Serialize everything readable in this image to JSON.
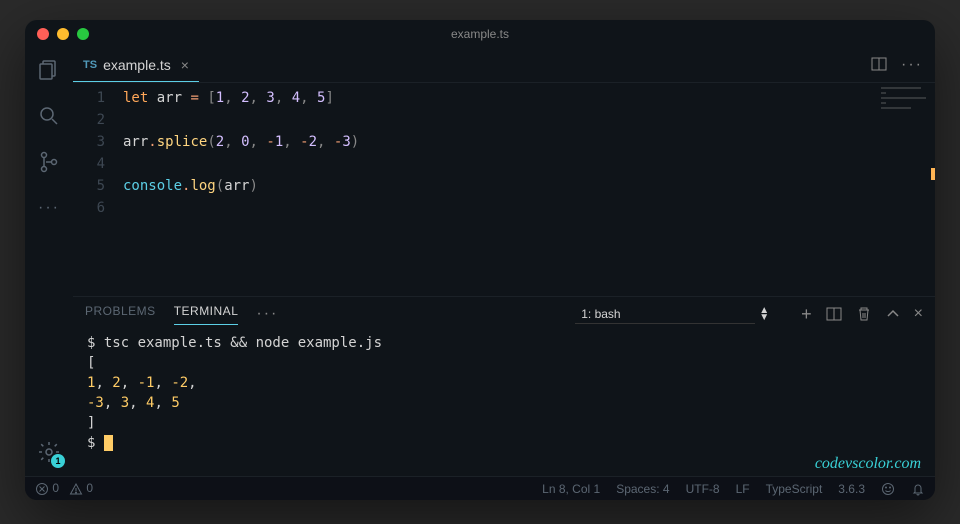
{
  "titlebar": {
    "title": "example.ts"
  },
  "tab": {
    "icon_label": "TS",
    "filename": "example.ts"
  },
  "activity": {
    "gear_badge": "1"
  },
  "code": {
    "lines": [
      "1",
      "2",
      "3",
      "4",
      "5",
      "6"
    ],
    "l1": {
      "let": "let",
      "var": "arr",
      "eq": "=",
      "lb": "[",
      "n1": "1",
      "c1": ",",
      "n2": "2",
      "c2": ",",
      "n3": "3",
      "c3": ",",
      "n4": "4",
      "c4": ",",
      "n5": "5",
      "rb": "]"
    },
    "l3": {
      "obj": "arr",
      "dot": ".",
      "fn": "splice",
      "lp": "(",
      "a1": "2",
      "c1": ",",
      "a2": "0",
      "c2": ",",
      "m1": "-",
      "a3": "1",
      "c3": ",",
      "m2": "-",
      "a4": "2",
      "c4": ",",
      "m3": "-",
      "a5": "3",
      "rp": ")"
    },
    "l5": {
      "obj": "console",
      "dot": ".",
      "fn": "log",
      "lp": "(",
      "arg": "arr",
      "rp": ")"
    }
  },
  "panel": {
    "tabs": {
      "problems": "PROBLEMS",
      "terminal": "TERMINAL"
    },
    "selector": "1: bash"
  },
  "terminal": {
    "cmd": "$ tsc example.ts && node example.js",
    "row_open": "[",
    "row1": {
      "pad": "  ",
      "n1": "1",
      "c1": ", ",
      "n2": "2",
      "c2": ", ",
      "n3": "-1",
      "c3": ", ",
      "n4": "-2",
      "c4": ","
    },
    "row2": {
      "pad": "  ",
      "n1": "-3",
      "c1": ", ",
      "n2": "3",
      "c2": ",  ",
      "n3": "4",
      "c3": ",  ",
      "n4": "5"
    },
    "row_close": "]",
    "prompt2": "$ "
  },
  "watermark": "codevscolor.com",
  "status": {
    "errors": "0",
    "warnings": "0",
    "ln_col": "Ln 8, Col 1",
    "spaces": "Spaces: 4",
    "encoding": "UTF-8",
    "eol": "LF",
    "lang": "TypeScript",
    "ver": "3.6.3"
  }
}
